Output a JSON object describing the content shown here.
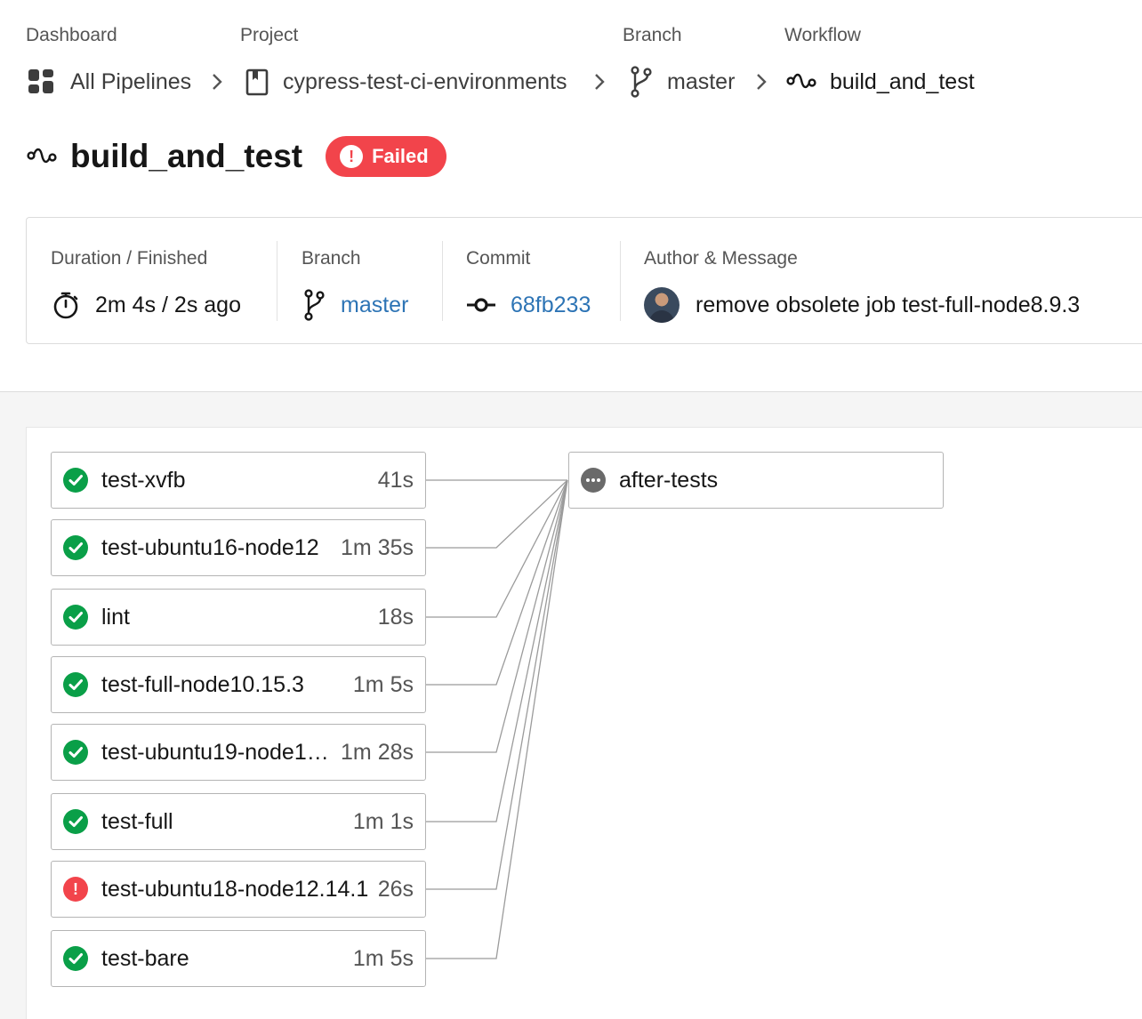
{
  "breadcrumb": {
    "labels": {
      "dashboard": "Dashboard",
      "project": "Project",
      "branch": "Branch",
      "workflow": "Workflow"
    },
    "items": {
      "pipelines": "All Pipelines",
      "project": "cypress-test-ci-environments",
      "branch": "master",
      "workflow": "build_and_test"
    }
  },
  "header": {
    "title": "build_and_test",
    "status": "Failed",
    "status_color": "#f2444b"
  },
  "summary": {
    "duration_label": "Duration / Finished",
    "duration_value": "2m 4s / 2s ago",
    "branch_label": "Branch",
    "branch_value": "master",
    "commit_label": "Commit",
    "commit_value": "68fb233",
    "author_label": "Author & Message",
    "message": "remove obsolete job test-full-node8.9.3",
    "link_color": "#2d74b5"
  },
  "jobs": [
    {
      "name": "test-xvfb",
      "duration": "41s",
      "status": "success"
    },
    {
      "name": "test-ubuntu16-node12",
      "duration": "1m 35s",
      "status": "success"
    },
    {
      "name": "lint",
      "duration": "18s",
      "status": "success"
    },
    {
      "name": "test-full-node10.15.3",
      "duration": "1m 5s",
      "status": "success"
    },
    {
      "name": "test-ubuntu19-node1…",
      "duration": "1m 28s",
      "status": "success"
    },
    {
      "name": "test-full",
      "duration": "1m 1s",
      "status": "success"
    },
    {
      "name": "test-ubuntu18-node12.14.1",
      "duration": "26s",
      "status": "failed"
    },
    {
      "name": "test-bare",
      "duration": "1m 5s",
      "status": "success"
    }
  ],
  "downstream_job": {
    "name": "after-tests",
    "status": "not-run"
  },
  "colors": {
    "success": "#0a9f48",
    "failed": "#f2444b",
    "not_run": "#6a6a6a"
  }
}
